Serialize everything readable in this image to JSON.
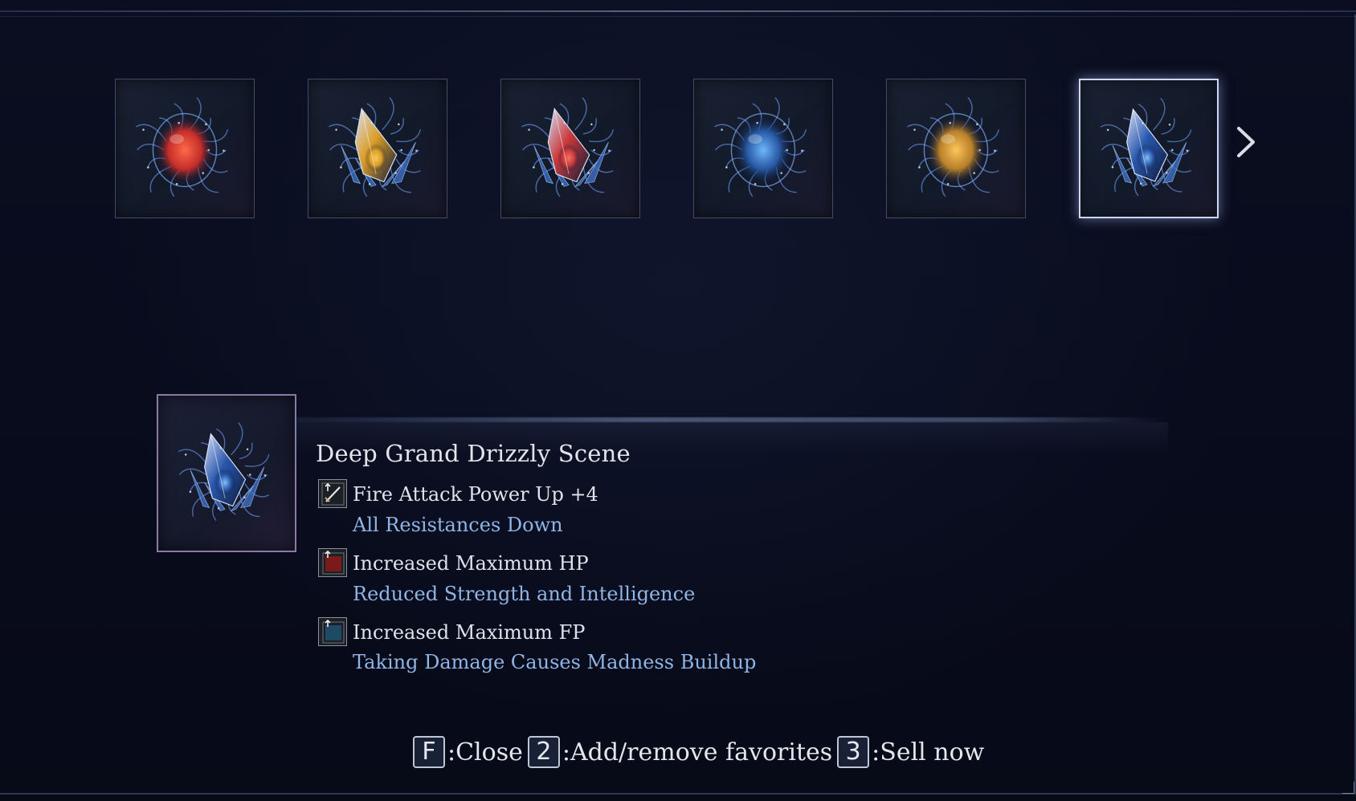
{
  "carousel": {
    "items": [
      {
        "name": "red-orb-relic-icon",
        "core": "#d9302a",
        "glow": "#ff6a4a",
        "shape": "orb",
        "tint": "#1a2233"
      },
      {
        "name": "gold-crystal-relic-icon",
        "core": "#e7a526",
        "glow": "#ffd35a",
        "shape": "crystal",
        "tint": "#1c1d34"
      },
      {
        "name": "red-crystal-relic-icon",
        "core": "#d33b3b",
        "glow": "#ff7a6a",
        "shape": "crystal",
        "tint": "#1a2233"
      },
      {
        "name": "blue-orb-relic-icon",
        "core": "#2a5fb0",
        "glow": "#6fb8ff",
        "shape": "orb",
        "tint": "#1a2233"
      },
      {
        "name": "amber-orb-relic-icon",
        "core": "#c98a2a",
        "glow": "#ffc75a",
        "shape": "orb",
        "tint": "#1f1d33"
      },
      {
        "name": "blue-crystal-relic-icon",
        "core": "#2b5bb4",
        "glow": "#8fd0ff",
        "shape": "crystal",
        "tint": "#1a2233",
        "selected": true
      }
    ],
    "next_icon": "chevron-right-icon"
  },
  "item": {
    "title": "Deep Grand Drizzly Scene",
    "icon": "blue-crystal-relic-icon",
    "effects": [
      {
        "label": "Fire Attack Power Up +4",
        "sub": "All Resistances Down",
        "icon": "sword-icon",
        "icon_color": "#2a2d33"
      },
      {
        "label": "Increased Maximum HP",
        "sub": "Reduced Strength and Intelligence",
        "icon": "red-square-icon",
        "icon_color": "#7a1a1a"
      },
      {
        "label": "Increased Maximum FP",
        "sub": "Taking Damage Causes Madness Buildup",
        "icon": "blue-square-icon",
        "icon_color": "#1e4a66"
      }
    ]
  },
  "hints": {
    "close_key": "F",
    "close_label": ":Close",
    "fav_key": "2",
    "fav_label": ":Add/remove favorites",
    "sell_key": "3",
    "sell_label": ":Sell now"
  },
  "colors": {
    "background": "#070a18",
    "effect_text": "#dfe2ea",
    "effect_sub": "#8fb4e6",
    "selection_border": "#cdd6f2"
  }
}
